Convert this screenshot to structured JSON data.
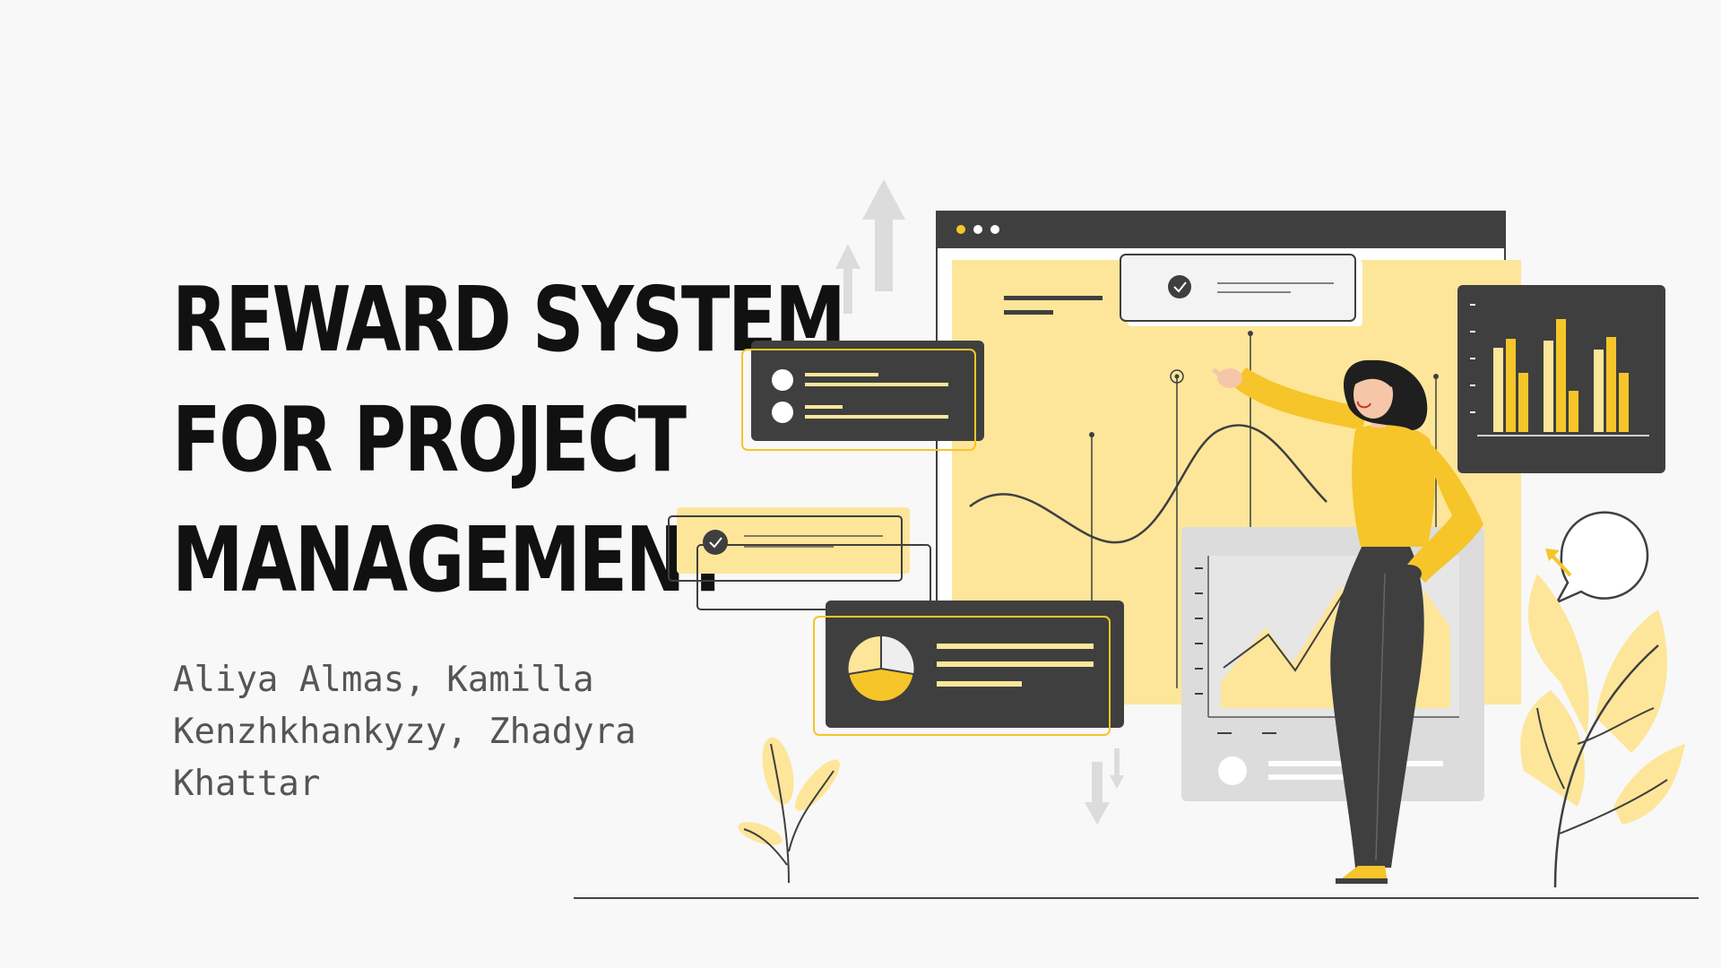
{
  "slide": {
    "title_lines": [
      "REWARD SYSTEM",
      "FOR PROJECT",
      "MANAGEMENT"
    ],
    "authors_line1": "Aliya Almas, Kamilla",
    "authors_line2": "Kenzhkhankyzy, Zhadyra Khattar"
  },
  "colors": {
    "background": "#f8f8f8",
    "accent_yellow": "#f5c52a",
    "light_yellow": "#fde69a",
    "dark": "#3f3f3f",
    "light_gray": "#dcdcdc"
  },
  "illustration": {
    "icons": [
      "woman-presenting-icon",
      "browser-window-icon",
      "bar-chart-card-icon",
      "pie-chart-card-icon",
      "list-card-icon",
      "check-card-icon",
      "speech-bubble-icon",
      "leaf-plant-icon",
      "arrow-up-icon",
      "arrow-down-icon"
    ]
  }
}
